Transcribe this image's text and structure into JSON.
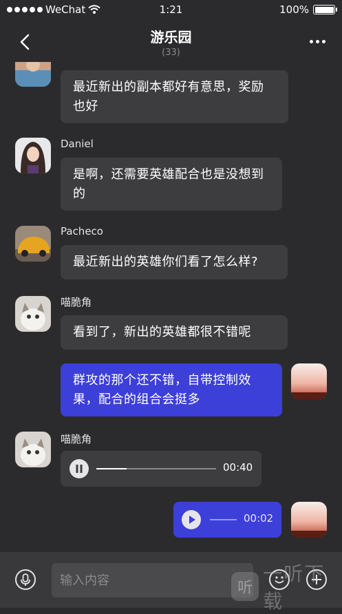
{
  "status_bar": {
    "carrier": "WeChat",
    "time": "1:21",
    "battery": "100%"
  },
  "header": {
    "title": "游乐园",
    "member_count": "(33)",
    "back_icon": "chevron-left-icon",
    "more_icon": "more-dots-icon"
  },
  "messages": [
    {
      "sender": "",
      "text": "最近新出的副本都好有意思，奖励也好",
      "mine": false
    },
    {
      "sender": "Daniel",
      "text": "是啊，还需要英雄配合也是没想到的",
      "mine": false
    },
    {
      "sender": "Pacheco",
      "text": "最近新出的英雄你们看了怎么样?",
      "mine": false
    },
    {
      "sender": "喵脆角",
      "text": "看到了，新出的英雄都很不错呢",
      "mine": false
    },
    {
      "sender": "",
      "text": "群攻的那个还不错，自带控制效果，配合的组合会挺多",
      "mine": true
    },
    {
      "sender": "喵脆角",
      "voice_duration": "00:40",
      "voice_state": "paused",
      "progress": 0.25,
      "mine": false
    },
    {
      "sender": "",
      "voice_duration": "00:02",
      "voice_state": "ready",
      "mine": true
    }
  ],
  "input_bar": {
    "placeholder": "输入内容",
    "mic_icon": "microphone-icon",
    "emoji_icon": "emoji-icon",
    "plus_icon": "plus-icon"
  },
  "watermark": {
    "logo_text": "听",
    "text": "一听下载"
  },
  "colors": {
    "background": "#2b2b2d",
    "bubble_other": "#3d3d40",
    "bubble_mine": "#3d3fd9",
    "input_bar": "#39393b"
  }
}
